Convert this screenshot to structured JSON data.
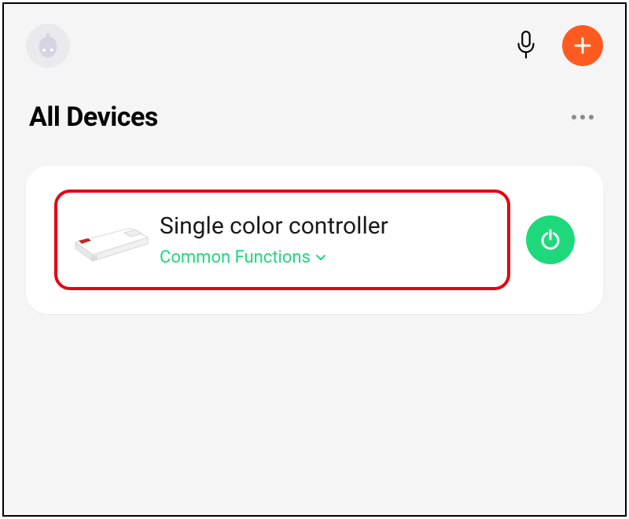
{
  "header": {
    "avatar_icon": "robot-avatar",
    "mic_icon": "microphone",
    "add_icon": "plus"
  },
  "section": {
    "title": "All Devices",
    "more_icon": "more-horizontal"
  },
  "device": {
    "name": "Single color controller",
    "functions_label": "Common Functions",
    "functions_expand_icon": "chevron-down",
    "power_icon": "power",
    "highlight_color": "#e60012",
    "functions_color": "#1ed97b"
  }
}
